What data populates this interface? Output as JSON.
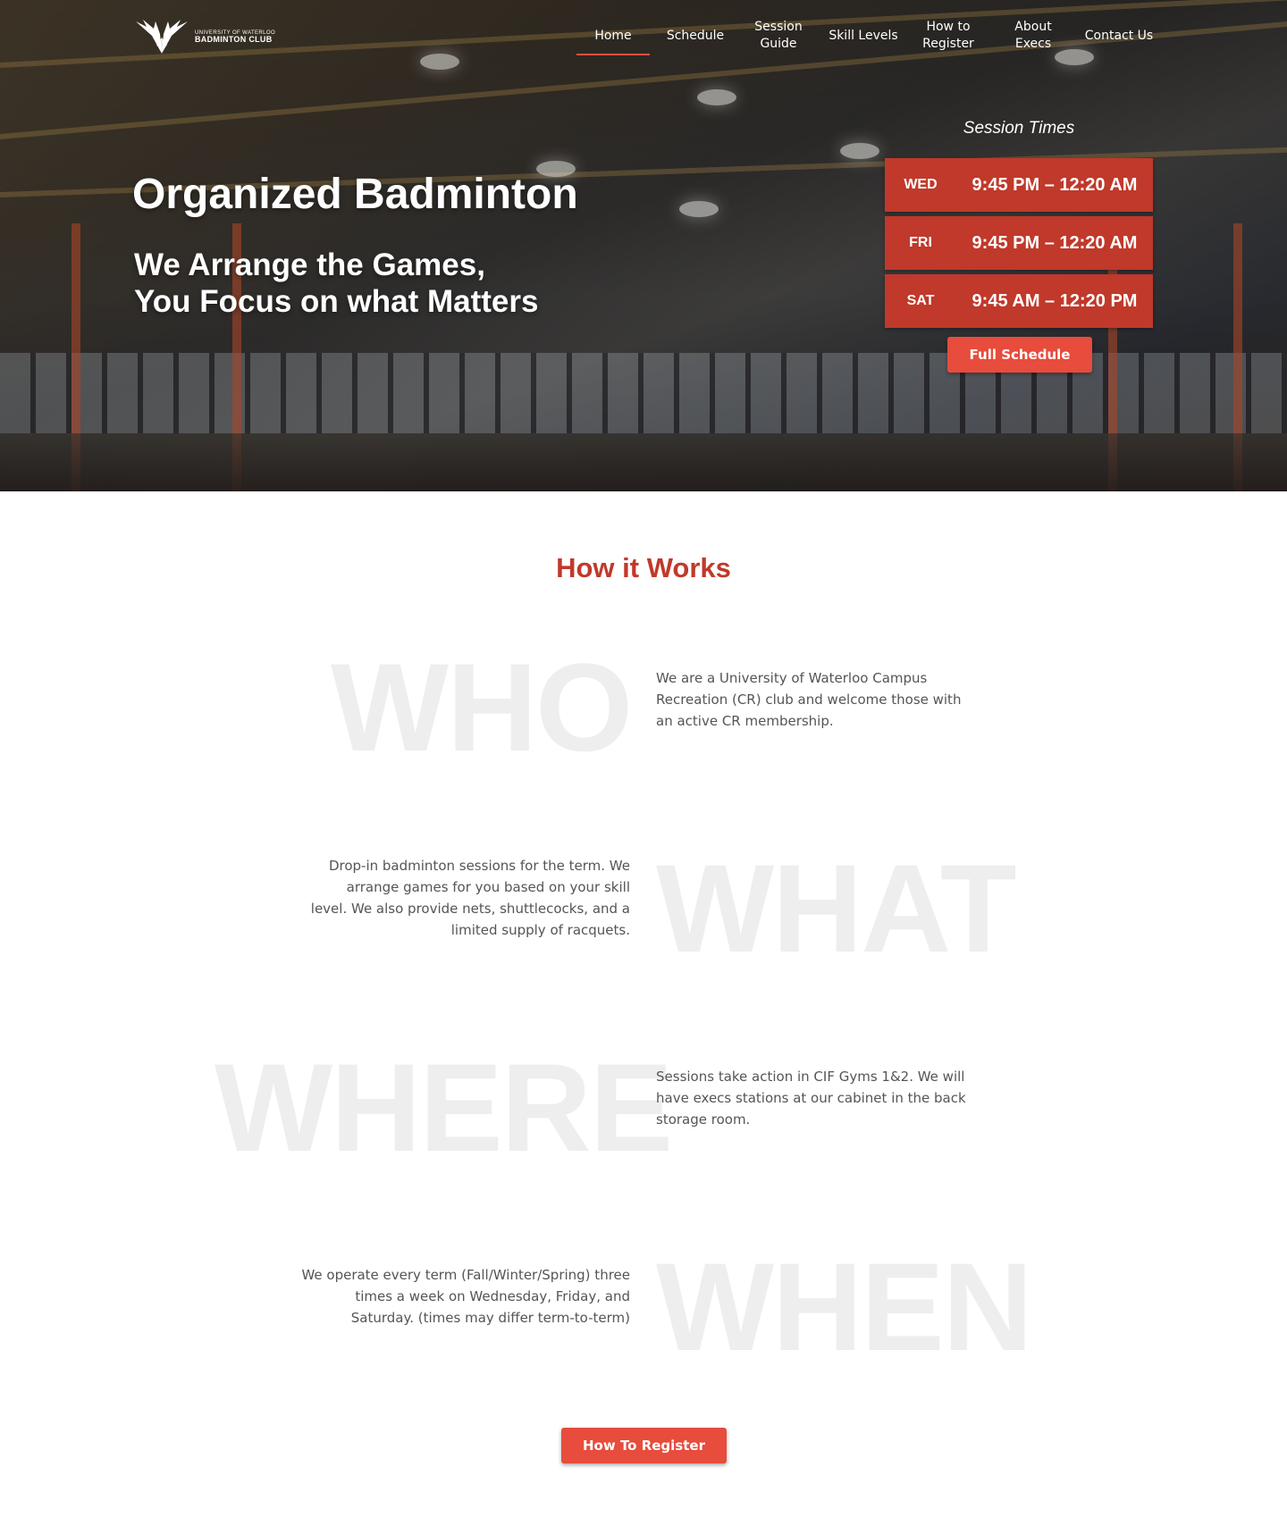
{
  "logo": {
    "line1": "University of Waterloo",
    "line2": "BADMINTON CLUB"
  },
  "nav": {
    "items": [
      {
        "label": "Home",
        "active": true
      },
      {
        "label": "Schedule",
        "active": false
      },
      {
        "label": "Session Guide",
        "active": false
      },
      {
        "label": "Skill Levels",
        "active": false
      },
      {
        "label": "How to Register",
        "active": false
      },
      {
        "label": "About Execs",
        "active": false
      },
      {
        "label": "Contact Us",
        "active": false
      }
    ]
  },
  "hero": {
    "title": "Organized Badminton",
    "subtitle_line1": "We Arrange the Games,",
    "subtitle_line2": "You Focus on what Matters"
  },
  "sessions": {
    "title": "Session Times",
    "rows": [
      {
        "day": "WED",
        "time": "9:45 PM – 12:20 AM"
      },
      {
        "day": "FRI",
        "time": "9:45 PM – 12:20 AM"
      },
      {
        "day": "SAT",
        "time": "9:45 AM – 12:20 PM"
      }
    ],
    "button_label": "Full Schedule"
  },
  "how": {
    "title": "How it Works",
    "items": [
      {
        "word": "WHO",
        "text": "We are a University of Waterloo Campus Recreation (CR) club and welcome those with an active CR membership."
      },
      {
        "word": "WHAT",
        "text": "Drop-in badminton sessions for the term. We arrange games for you based on your skill level. We also provide nets, shuttlecocks, and a limited supply of racquets."
      },
      {
        "word": "WHERE",
        "text": "Sessions take action in CIF Gyms 1&2. We will have execs stations at our cabinet in the back storage room."
      },
      {
        "word": "WHEN",
        "text": "We operate every term (Fall/Winter/Spring) three times a week on Wednesday, Friday, and Saturday. (times may differ term-to-term)"
      }
    ],
    "button_label": "How To Register"
  },
  "colors": {
    "accent": "#c0392b",
    "button": "#e74c3c",
    "watermark": "#eeeeee"
  }
}
